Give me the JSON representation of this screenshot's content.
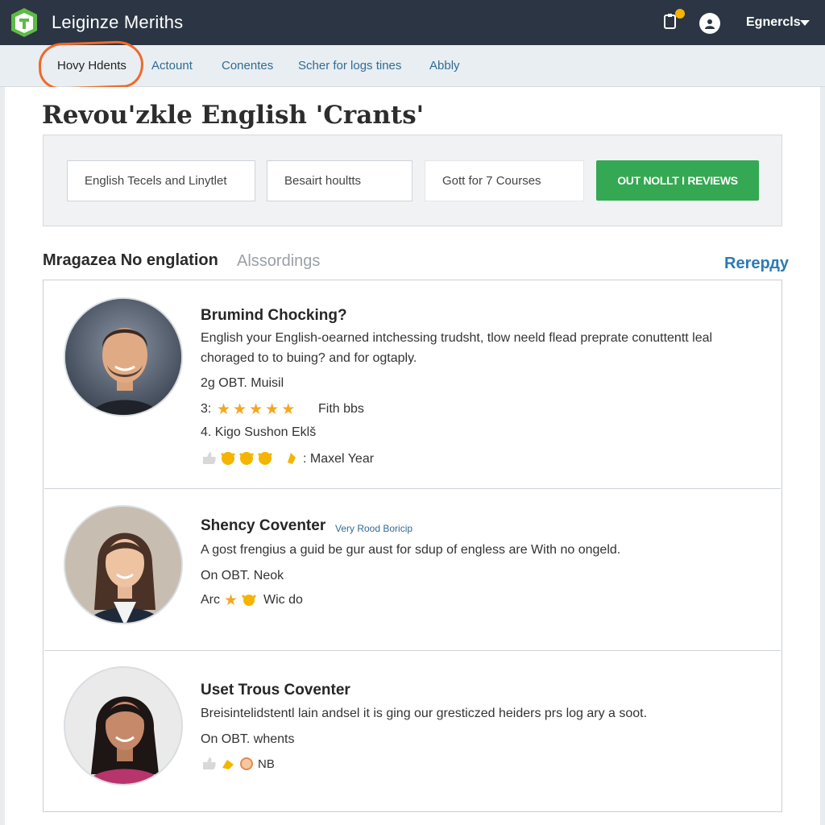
{
  "app": {
    "brand": "Leiginze Meriths"
  },
  "header": {
    "language": "Egnercls"
  },
  "nav": {
    "items": [
      "Hovy Hdents",
      "Actount",
      "Conentes",
      "Scher for logs tines",
      "Abbly"
    ]
  },
  "page": {
    "title": "Revou'zkle English 'Crants'"
  },
  "filters": {
    "input1": "English Tecels and Linytlet",
    "input2": "Besairt houltts",
    "input3": "Gott for 7 Courses",
    "button": "OUT NOLLT I REVIEWS"
  },
  "section": {
    "title": "Mragazea No englation",
    "subtitle": "Alssordings",
    "link": "Rerердy"
  },
  "reviews": [
    {
      "name": "Brumind Chocking?",
      "text1": "English your English-oearned intchessing trudsht, tlow neeld flead preprate conuttentt leal",
      "text2": "choraged to to buing? and for ogtaply.",
      "meta1": "2g OBT.  Muisil",
      "rating_prefix": "3:",
      "rating": 5,
      "rating_suffix": "Fith bbs",
      "meta3": "4. Kigo Sushon Eklš",
      "footer": ": Maxel Year"
    },
    {
      "name": "Shency Coventer",
      "tag": "Very Rood Boricip",
      "text1": "A gost frengius a guid be gur aust for sdup of engless are With no ongeld.",
      "meta1": "On OBT.   Neok",
      "rating_prefix": "Arc",
      "footer": "Wic do"
    },
    {
      "name": "Uset Trous Coventer",
      "text1": "Breisintelidstentl lain andsel it is ging our gresticzed heiders prs log ary a soot.",
      "meta1": "On OBT.   whents",
      "footer": "NB"
    }
  ],
  "colors": {
    "header": "#2b3543",
    "accent_green": "#35a853",
    "link_blue": "#2f7ab3",
    "star": "#f5a623",
    "annotation": "#ef6a2a"
  }
}
